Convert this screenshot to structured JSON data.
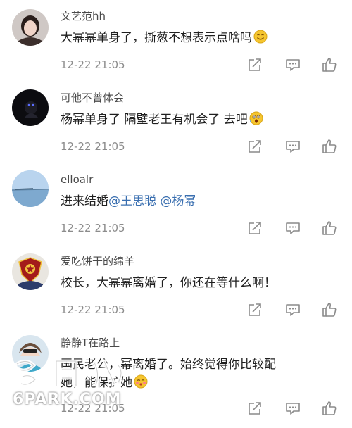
{
  "comments": [
    {
      "username": "文艺范hh",
      "text": "大幂幂单身了，撕葱不想表示点啥吗",
      "emoji": "smile",
      "time": "12-22 21:05"
    },
    {
      "username": "可他不曾体会",
      "text": "杨幂单身了 隔壁老王有机会了 去吧",
      "emoji": "shocked",
      "time": "12-22 21:05"
    },
    {
      "username": "elloalr",
      "text_prefix": "进来结婚",
      "mentions": [
        "@王思聪",
        "@杨幂"
      ],
      "time": "12-22 21:05"
    },
    {
      "username": "爱吃饼干的绵羊",
      "text": "校长，大幂幂离婚了，你还在等什么啊！",
      "time": "12-22 21:05"
    },
    {
      "username": "静静T在路上",
      "text_line1": "国民老公，幂离婚了。始终觉得你比较配",
      "text_line2": "她，能保护她",
      "emoji": "blush",
      "time": "12-22 21:05"
    }
  ],
  "icons": [
    "share-icon",
    "comment-icon",
    "like-icon"
  ],
  "watermark": {
    "chars": "留园网",
    "url": "6PARK.COM"
  },
  "colors": {
    "mention": "#3a6fb0",
    "time": "#8c8c8c",
    "icon": "#8a8a8a"
  }
}
